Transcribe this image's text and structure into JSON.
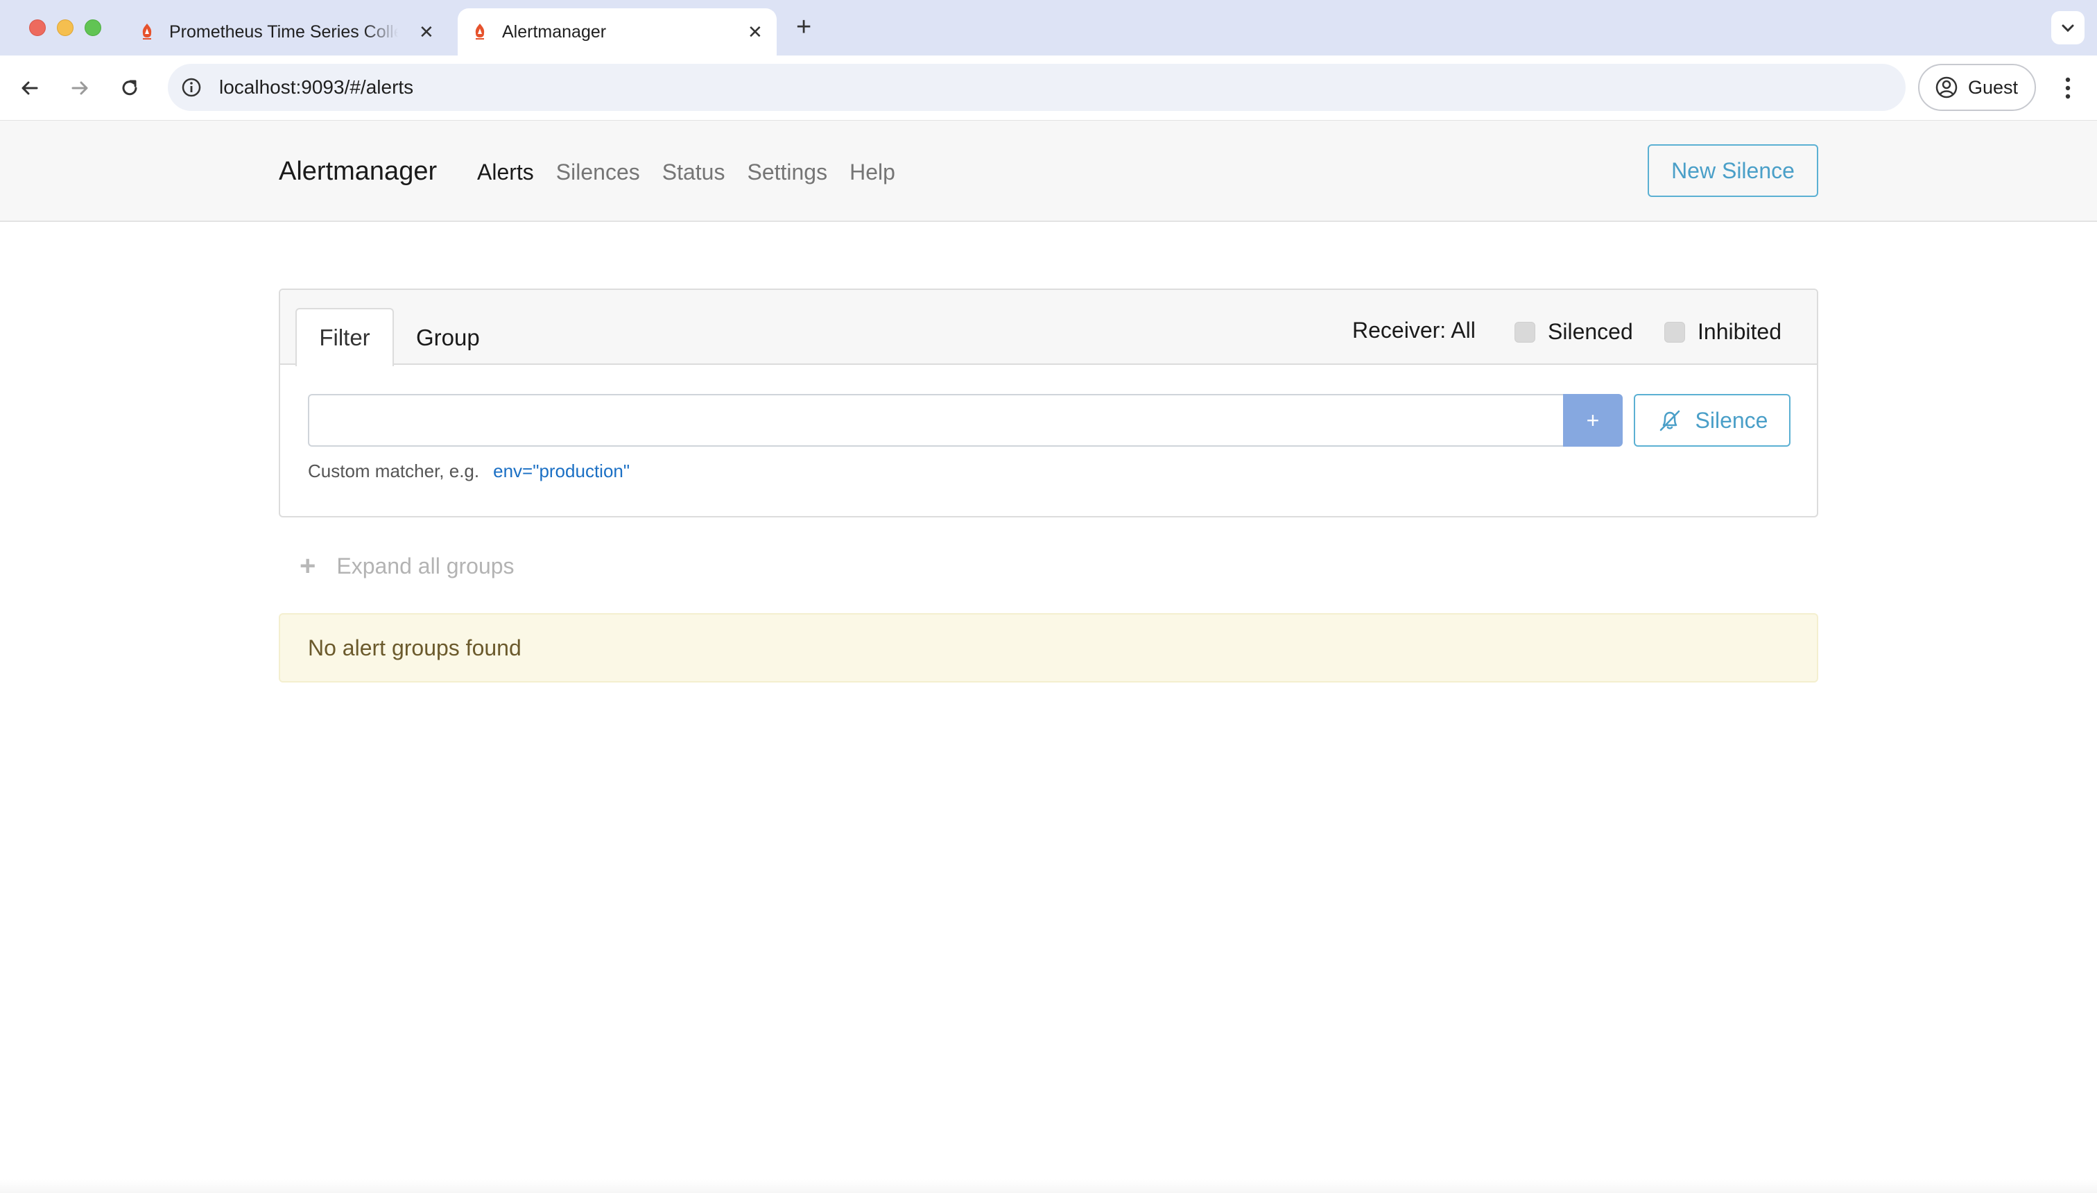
{
  "browser": {
    "tabs": [
      {
        "title": "Prometheus Time Series Collection and Processing Server",
        "active": false
      },
      {
        "title": "Alertmanager",
        "active": true
      }
    ],
    "url": "localhost:9093/#/alerts",
    "profile": "Guest"
  },
  "app": {
    "brand": "Alertmanager",
    "nav": [
      "Alerts",
      "Silences",
      "Status",
      "Settings",
      "Help"
    ],
    "active_nav": "Alerts",
    "new_silence": "New Silence"
  },
  "filter_card": {
    "tab_filter": "Filter",
    "tab_group": "Group",
    "receiver": "Receiver: All",
    "silenced": "Silenced",
    "inhibited": "Inhibited",
    "input_value": "",
    "add_label": "+",
    "silence_label": "Silence",
    "hint_text": "Custom matcher, e.g.",
    "hint_example": "env=\"production\""
  },
  "expand_label": "Expand all groups",
  "no_alerts": "No alert groups found",
  "colors": {
    "accent": "#5bb0d3",
    "add_button": "#86a8e0",
    "warning_bg": "#fbf8e6",
    "favicon": "#e6522c"
  }
}
